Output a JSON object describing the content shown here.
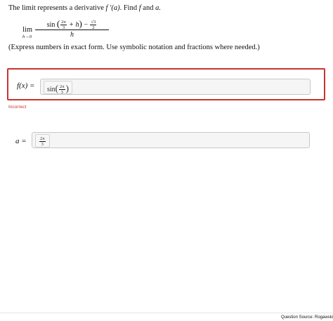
{
  "question": {
    "intro_text": "The limit represents a derivative",
    "fprime_text": "f ′(a)",
    "find_text": ". Find",
    "f_var": "f",
    "and_text": "and",
    "a_var": "a.",
    "limit": {
      "lim_word": "lim",
      "lim_sub": "h→0",
      "sin_word": "sin",
      "frac_num": "2π",
      "frac_den": "3",
      "plus_h": "+ h",
      "minus": "−",
      "sqrt_num": "√3",
      "sqrt_den": "2",
      "denominator": "h"
    },
    "instruction": "(Express numbers in exact form. Use symbolic notation and fractions where needed.)"
  },
  "answers": {
    "f_label": "f(x) =",
    "f_value_func": "sin",
    "f_value_num": "2π",
    "f_value_den": "3",
    "f_status": "Incorrect",
    "a_label": "a =",
    "a_value_num": "2π",
    "a_value_den": "3"
  },
  "footer": {
    "source": "Question Source: Rogawski"
  },
  "colors": {
    "error": "#c9332f",
    "field_bg": "#f5f5f5"
  }
}
